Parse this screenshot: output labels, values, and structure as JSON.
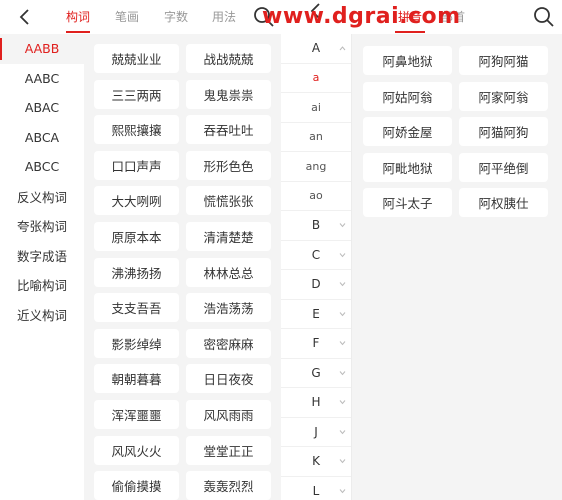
{
  "left": {
    "tabs": [
      "构词",
      "笔画",
      "字数",
      "用法"
    ],
    "categories": [
      "AABB",
      "AABC",
      "ABAC",
      "ABCA",
      "ABCC",
      "反义构词",
      "夸张构词",
      "数字成语",
      "比喻构词",
      "近义构词"
    ],
    "words": [
      "兢兢业业",
      "战战兢兢",
      "三三两两",
      "鬼鬼祟祟",
      "熙熙攘攘",
      "吞吞吐吐",
      "口口声声",
      "形形色色",
      "大大咧咧",
      "慌慌张张",
      "原原本本",
      "清清楚楚",
      "沸沸扬扬",
      "林林总总",
      "支支吾吾",
      "浩浩荡荡",
      "影影绰绰",
      "密密麻麻",
      "朝朝暮暮",
      "日日夜夜",
      "浑浑噩噩",
      "风风雨雨",
      "风风火火",
      "堂堂正正",
      "偷偷摸摸",
      "轰轰烈烈"
    ]
  },
  "right": {
    "tabs": [
      "拼音",
      "部首"
    ],
    "letters": [
      "A",
      "a",
      "ai",
      "an",
      "ang",
      "ao",
      "B",
      "C",
      "D",
      "E",
      "F",
      "G",
      "H",
      "J",
      "K",
      "L"
    ],
    "words": [
      "阿鼻地狱",
      "阿狗阿猫",
      "阿姑阿翁",
      "阿家阿翁",
      "阿娇金屋",
      "阿猫阿狗",
      "阿毗地狱",
      "阿平绝倒",
      "阿斗太子",
      "阿权胰仕"
    ]
  },
  "watermark": "www.dgrai.com",
  "colors": {
    "accent": "#e0201e",
    "bg": "#f4f4f4",
    "text": "#333333"
  }
}
